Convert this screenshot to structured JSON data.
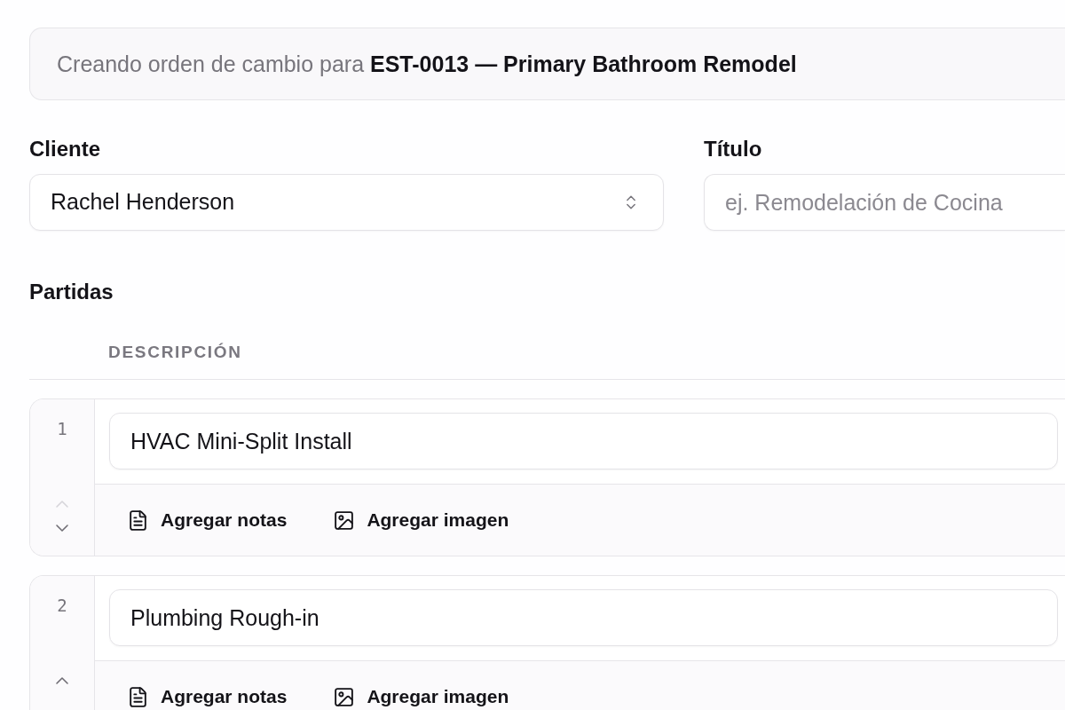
{
  "banner": {
    "text": "Creando orden de cambio para **EST-0013 — Primary Bathroom Remodel**"
  },
  "fields": [
    {
      "kind": "select",
      "label": "Cliente",
      "value": "Rachel Henderson"
    },
    {
      "kind": "text",
      "label": "Título",
      "placeholder": "ej. Remodelación de Cocina"
    }
  ],
  "line_items": {
    "title": "Partidas",
    "columns": [
      "DESCRIPCIÓN"
    ],
    "items": [
      {
        "number": "1",
        "description": "HVAC Mini-Split Install",
        "move_up": {
          "disabled": true
        },
        "move_down": {
          "disabled": false
        },
        "actions": [
          {
            "kind": "notes",
            "label": "Agregar notas"
          },
          {
            "kind": "image",
            "label": "Agregar imagen"
          }
        ]
      },
      {
        "number": "2",
        "description": "Plumbing Rough-in",
        "move_up": {
          "disabled": false
        },
        "actions": [
          {
            "kind": "notes",
            "label": "Agregar notas"
          },
          {
            "kind": "image",
            "label": "Agregar imagen"
          }
        ]
      }
    ]
  }
}
